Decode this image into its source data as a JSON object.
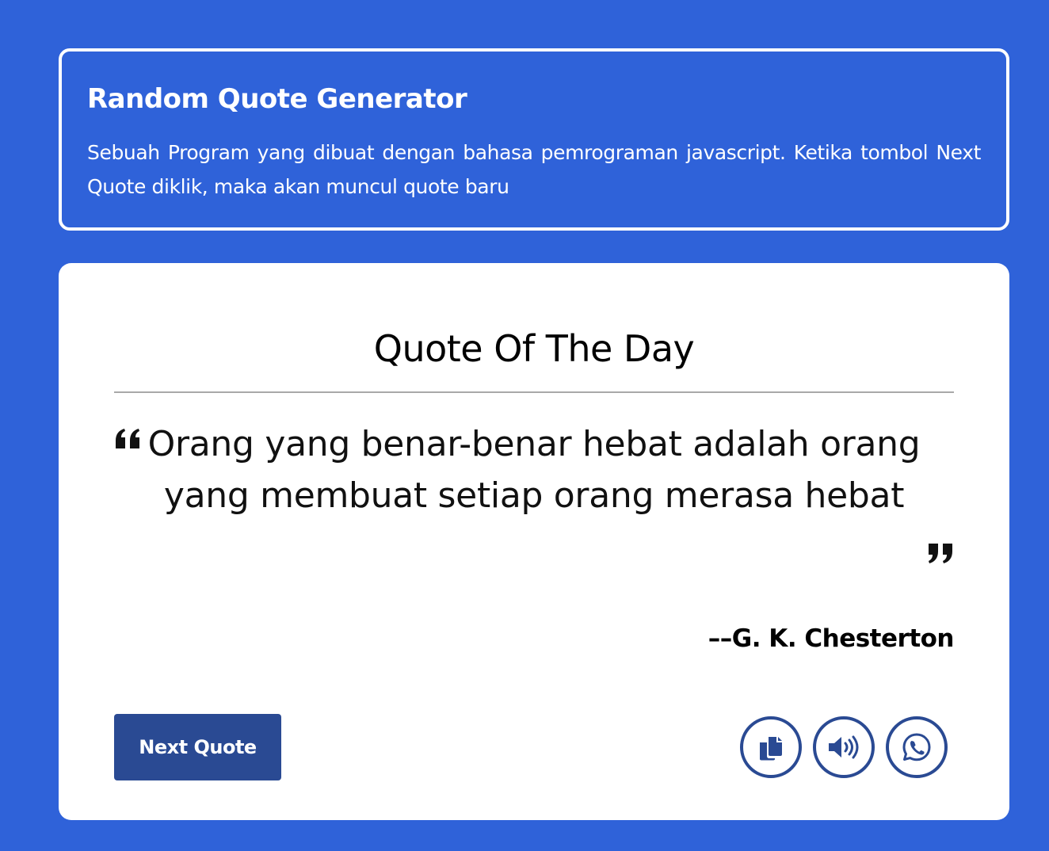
{
  "info": {
    "title": "Random Quote Generator",
    "description": "Sebuah Program yang dibuat dengan bahasa pemrograman javascript. Ketika tombol Next Quote diklik, maka akan muncul quote baru"
  },
  "card": {
    "title": "Quote Of The Day",
    "quote": "Orang yang benar-benar hebat adalah orang yang membuat setiap orang merasa hebat",
    "author": "––G. K. Chesterton",
    "next_button_label": "Next Quote",
    "actions": [
      {
        "name": "copy-icon"
      },
      {
        "name": "speaker-icon"
      },
      {
        "name": "whatsapp-icon"
      }
    ]
  },
  "colors": {
    "background": "#2f62d9",
    "button": "#2a4a93",
    "card": "#ffffff"
  }
}
